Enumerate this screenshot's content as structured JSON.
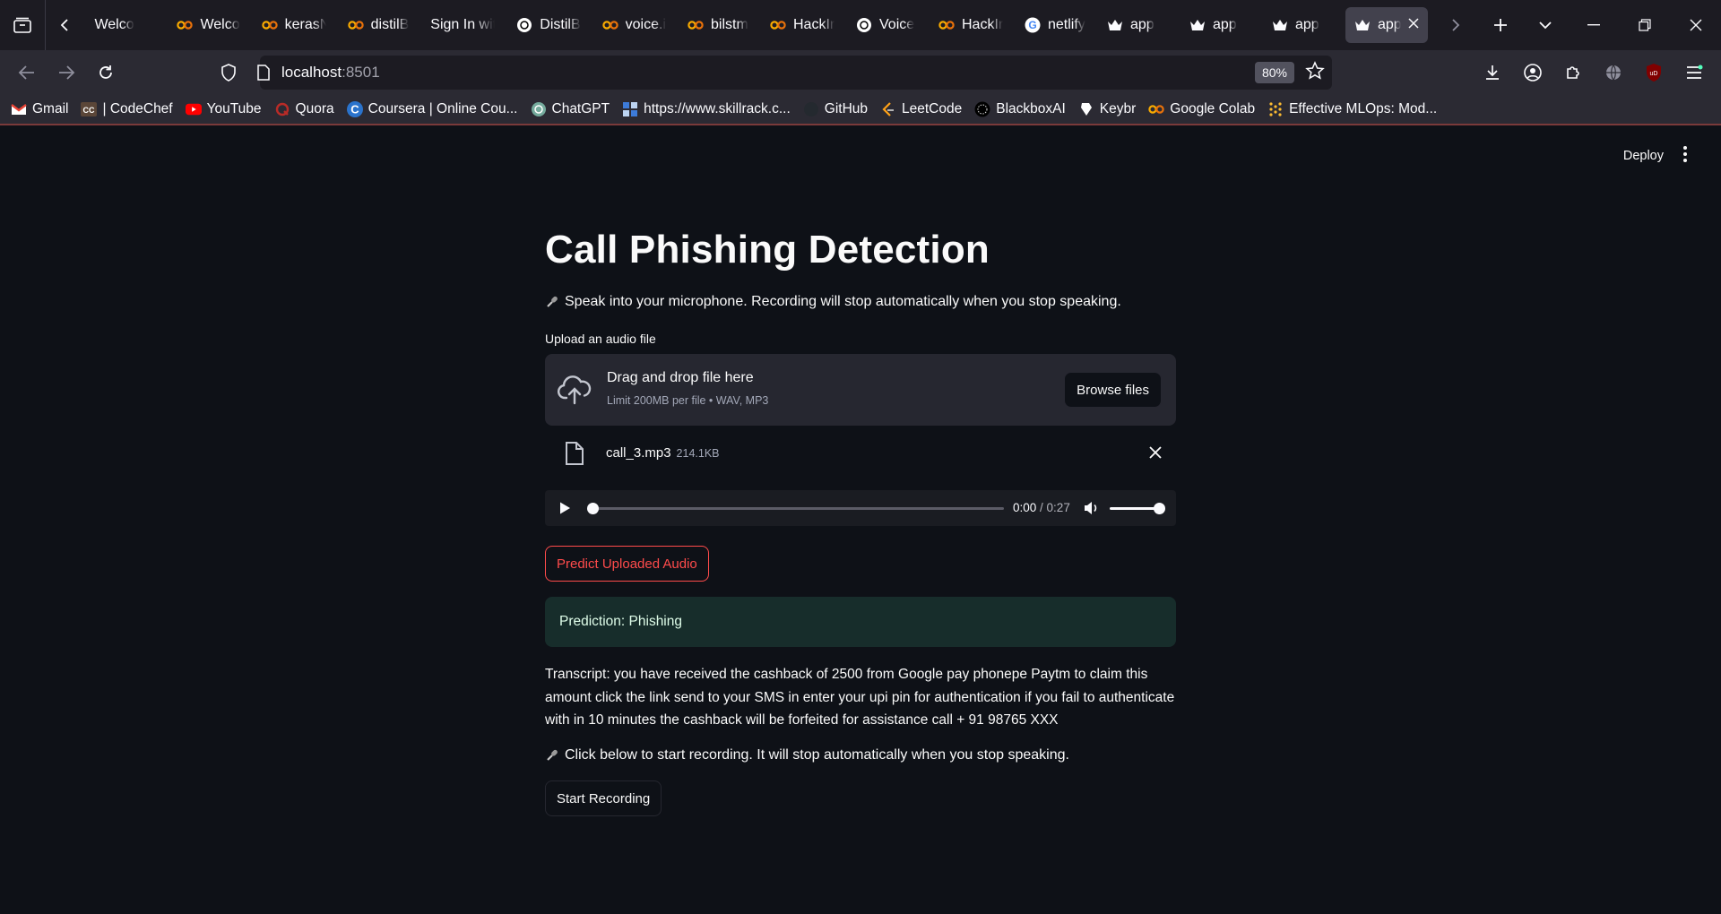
{
  "browser": {
    "tabs": [
      {
        "label": "Welco",
        "icon": "left-arrow-partial-icon"
      },
      {
        "label": "Welco",
        "icon": "colab-icon"
      },
      {
        "label": "kerasN",
        "icon": "colab-icon"
      },
      {
        "label": "distilB",
        "icon": "colab-icon"
      },
      {
        "label": "Sign In wit",
        "icon": "none"
      },
      {
        "label": "DistilB",
        "icon": "openai-icon"
      },
      {
        "label": "voice.i",
        "icon": "colab-icon"
      },
      {
        "label": "bilstm",
        "icon": "colab-icon"
      },
      {
        "label": "HackIr",
        "icon": "colab-icon"
      },
      {
        "label": "Voice",
        "icon": "openai-icon"
      },
      {
        "label": "HackIr",
        "icon": "colab-icon"
      },
      {
        "label": "netlify",
        "icon": "google-icon"
      },
      {
        "label": "app",
        "icon": "streamlit-crown-icon"
      },
      {
        "label": "app",
        "icon": "streamlit-crown-icon"
      },
      {
        "label": "app",
        "icon": "streamlit-crown-icon"
      },
      {
        "label": "app",
        "icon": "streamlit-crown-icon",
        "active": true
      }
    ],
    "url_host": "localhost",
    "url_port": ":8501",
    "zoom": "80%",
    "bookmarks": [
      {
        "label": "Gmail",
        "icon": "gmail-icon"
      },
      {
        "label": "| CodeChef",
        "icon": "codechef-icon"
      },
      {
        "label": "YouTube",
        "icon": "youtube-icon"
      },
      {
        "label": "Quora",
        "icon": "quora-icon"
      },
      {
        "label": "Coursera | Online Cou...",
        "icon": "coursera-icon"
      },
      {
        "label": "ChatGPT",
        "icon": "chatgpt-icon"
      },
      {
        "label": "https://www.skillrack.c...",
        "icon": "skillrack-icon"
      },
      {
        "label": "GitHub",
        "icon": "github-icon"
      },
      {
        "label": "LeetCode",
        "icon": "leetcode-icon"
      },
      {
        "label": "BlackboxAI",
        "icon": "blackbox-icon"
      },
      {
        "label": "Keybr",
        "icon": "keybr-icon"
      },
      {
        "label": "Google Colab",
        "icon": "colab-icon"
      },
      {
        "label": "Effective MLOps: Mod...",
        "icon": "wandb-icon"
      }
    ]
  },
  "app": {
    "deploy_label": "Deploy",
    "title": "Call Phishing Detection",
    "intro_text": "Speak into your microphone. Recording will stop automatically when you stop speaking.",
    "upload_label": "Upload an audio file",
    "dropzone_title": "Drag and drop file here",
    "dropzone_sub": "Limit 200MB per file • WAV, MP3",
    "browse_label": "Browse files",
    "file_name": "call_3.mp3",
    "file_size": "214.1KB",
    "audio_current": "0:00",
    "audio_duration": "/ 0:27",
    "audio_progress": 0,
    "audio_volume": 1.0,
    "predict_label": "Predict Uploaded Audio",
    "prediction_text": "Prediction: Phishing",
    "transcript": "Transcript: you have received the cashback of 2500 from Google pay phonepe Paytm to claim this amount click the link send to your SMS in enter your upi pin for authentication if you fail to authenticate with in 10 minutes the cashback will be forfeited for assistance call + 91 98765 XXX",
    "record_hint": "Click below to start recording. It will stop automatically when you stop speaking.",
    "record_label": "Start Recording"
  },
  "colors": {
    "background": "#0e1117",
    "accent": "#ff4b4b",
    "success_bg": "#172d2b",
    "success_text": "#dffde9"
  }
}
